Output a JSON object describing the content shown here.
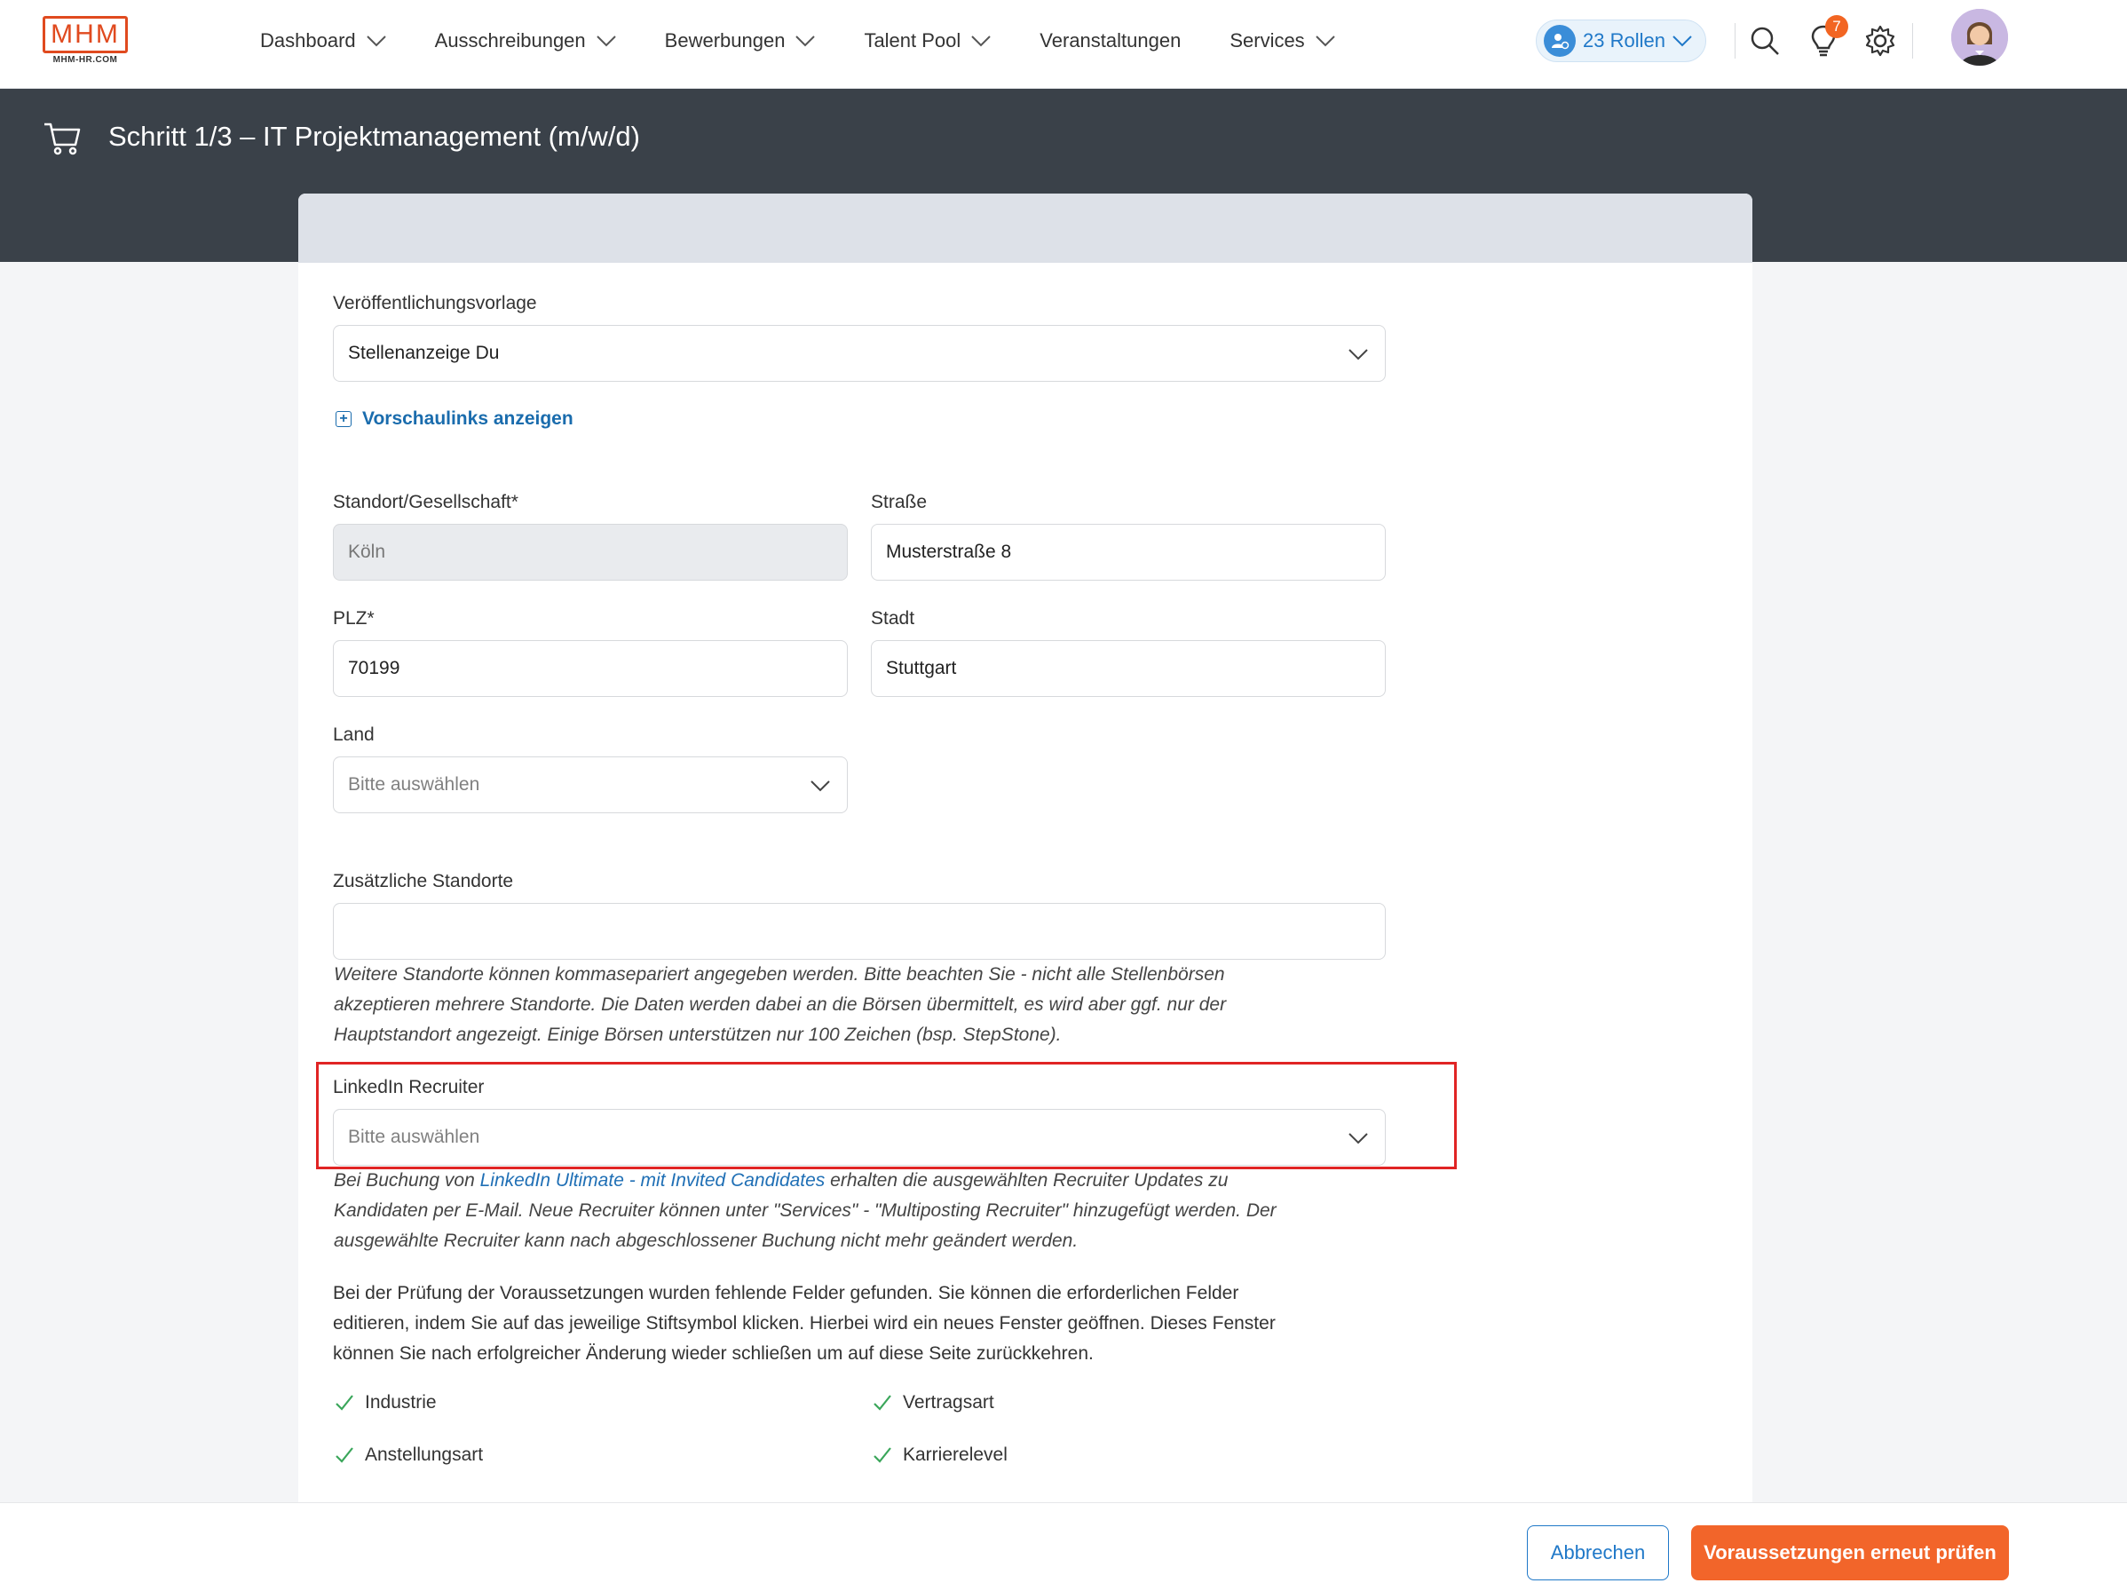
{
  "logo": {
    "text": "MHM",
    "subtext": "MHM-HR.COM"
  },
  "nav": {
    "items": [
      {
        "label": "Dashboard",
        "has_dropdown": true
      },
      {
        "label": "Ausschreibungen",
        "has_dropdown": true
      },
      {
        "label": "Bewerbungen",
        "has_dropdown": true
      },
      {
        "label": "Talent Pool",
        "has_dropdown": true
      },
      {
        "label": "Veranstaltungen",
        "has_dropdown": false
      },
      {
        "label": "Services",
        "has_dropdown": true
      }
    ],
    "roles_label": "23 Rollen",
    "notification_count": "7",
    "icons": [
      "search-icon",
      "lightbulb-icon",
      "gear-icon"
    ]
  },
  "header": {
    "title": "Schritt 1/3 – IT Projektmanagement (m/w/d)",
    "icon": "cart-icon"
  },
  "form": {
    "template": {
      "label": "Veröffentlichungsvorlage",
      "value": "Stellenanzeige Du"
    },
    "preview_link": "Vorschaulinks anzeigen",
    "location": {
      "label": "Standort/Gesellschaft*",
      "value": "Köln"
    },
    "street": {
      "label": "Straße",
      "value": "Musterstraße 8"
    },
    "zip": {
      "label": "PLZ*",
      "value": "70199"
    },
    "city": {
      "label": "Stadt",
      "value": "Stuttgart"
    },
    "country": {
      "label": "Land",
      "placeholder": "Bitte auswählen"
    },
    "additional_locations": {
      "label": "Zusätzliche Standorte",
      "value": "",
      "hint_line1": "Weitere Standorte können kommasepariert angegeben werden. Bitte beachten Sie - nicht alle Stellenbörsen",
      "hint_line2": "akzeptieren mehrere Standorte. Die Daten werden dabei an die Börsen übermittelt, es wird aber ggf. nur der",
      "hint_line3": "Hauptstandort angezeigt. Einige Börsen unterstützen nur 100 Zeichen (bsp. StepStone)."
    },
    "linkedin_recruiter": {
      "label": "LinkedIn Recruiter",
      "placeholder": "Bitte auswählen",
      "hint_prefix": "Bei Buchung von ",
      "hint_link": "LinkedIn Ultimate - mit Invited Candidates",
      "hint_suffix": " erhalten die ausgewählten Recruiter Updates zu",
      "hint_line2": "Kandidaten per E-Mail. Neue Recruiter können unter \"Services\" - \"Multiposting Recruiter\" hinzugefügt werden. Der",
      "hint_line3": "ausgewählte Recruiter kann nach abgeschlossener Buchung nicht mehr geändert werden."
    },
    "requirements_text": {
      "line1": "Bei der Prüfung der Voraussetzungen wurden fehlende Felder gefunden. Sie können die erforderlichen Felder",
      "line2": "editieren, indem Sie auf das jeweilige Stiftsymbol klicken. Hierbei wird ein neues Fenster geöffnen. Dieses Fenster",
      "line3": "können Sie nach erfolgreicher Änderung wieder schließen um auf diese Seite zurückkehren."
    },
    "checks": [
      {
        "label": "Industrie",
        "status": "ok"
      },
      {
        "label": "Vertragsart",
        "status": "ok"
      },
      {
        "label": "Anstellungsart",
        "status": "ok"
      },
      {
        "label": "Karrierelevel",
        "status": "ok"
      }
    ]
  },
  "footer": {
    "cancel_label": "Abbrechen",
    "submit_label": "Voraussetzungen erneut prüfen"
  },
  "colors": {
    "accent": "#f2652a",
    "link": "#1f78c8",
    "dark_header": "#3a4149",
    "check": "#3aa65a",
    "highlight": "#e02424"
  }
}
